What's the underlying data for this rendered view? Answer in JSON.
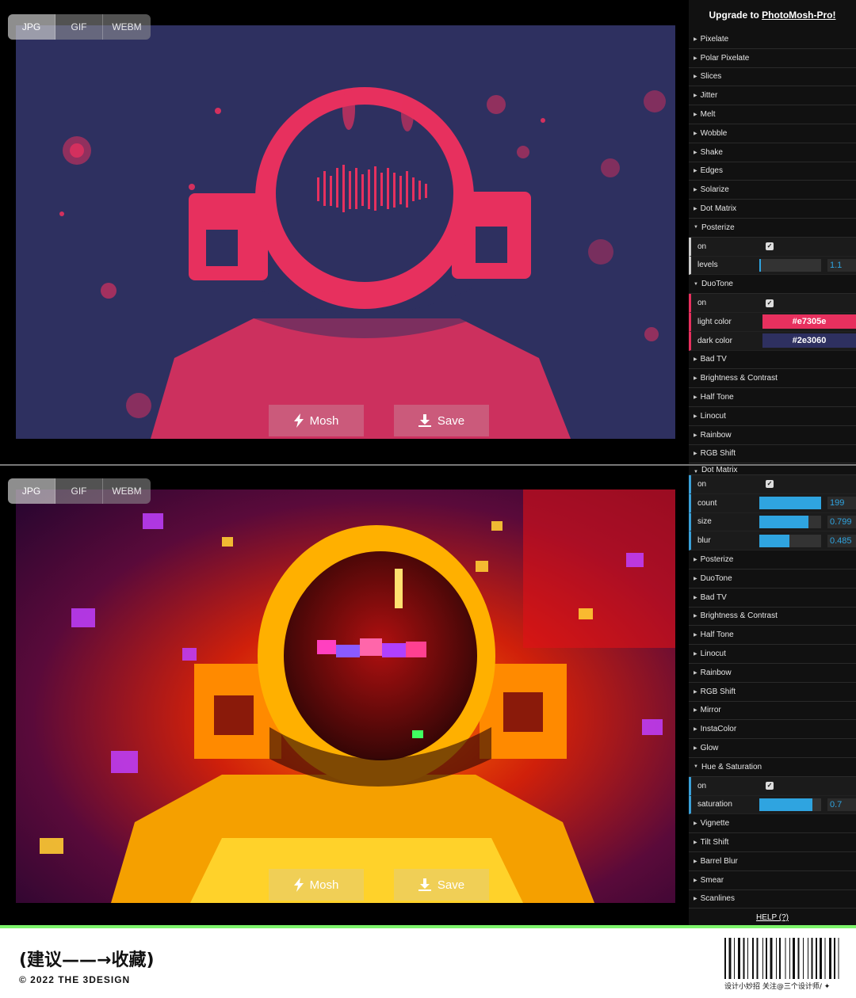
{
  "frame1": {
    "format_tabs": [
      "JPG",
      "GIF",
      "WEBM"
    ],
    "active_format": "JPG",
    "mosh_label": "Mosh",
    "save_label": "Save",
    "panel": {
      "upgrade_prefix": "Upgrade to ",
      "upgrade_link": "PhotoMosh-Pro!",
      "effects_before": [
        "Pixelate",
        "Polar Pixelate",
        "Slices",
        "Jitter",
        "Melt",
        "Wobble",
        "Shake",
        "Edges",
        "Solarize",
        "Dot Matrix"
      ],
      "posterize": {
        "label": "Posterize",
        "on_label": "on",
        "levels_label": "levels",
        "levels_value": "1.1",
        "levels_fill": 0.02
      },
      "duotone": {
        "label": "DuoTone",
        "on_label": "on",
        "light_label": "light color",
        "light_value": "#e7305e",
        "dark_label": "dark color",
        "dark_value": "#2e3060"
      },
      "effects_after": [
        "Bad TV",
        "Brightness & Contrast",
        "Half Tone",
        "Linocut",
        "Rainbow",
        "RGB Shift"
      ]
    }
  },
  "frame2": {
    "format_tabs": [
      "JPG",
      "GIF",
      "WEBM"
    ],
    "active_format": "JPG",
    "mosh_label": "Mosh",
    "save_label": "Save",
    "panel": {
      "dot_matrix": {
        "label": "Dot Matrix",
        "on_label": "on",
        "count_label": "count",
        "count_value": "199",
        "count_fill": 1.0,
        "size_label": "size",
        "size_value": "0.799",
        "size_fill": 0.8,
        "blur_label": "blur",
        "blur_value": "0.485",
        "blur_fill": 0.485
      },
      "effects_middle": [
        "Posterize",
        "DuoTone",
        "Bad TV",
        "Brightness & Contrast",
        "Half Tone",
        "Linocut",
        "Rainbow",
        "RGB Shift",
        "Mirror",
        "InstaColor",
        "Glow"
      ],
      "hue_saturation": {
        "label": "Hue & Saturation",
        "on_label": "on",
        "saturation_label": "saturation",
        "saturation_value": "0.7",
        "saturation_fill": 0.86
      },
      "effects_end": [
        "Vignette",
        "Tilt Shift",
        "Barrel Blur",
        "Smear",
        "Scanlines"
      ],
      "help_label": "HELP (?)"
    }
  },
  "footer": {
    "title": "(建议——→收藏)",
    "copyright": "© 2022 THE 3DESIGN",
    "caption": "设计小妙招  关注@三个设计师/",
    "caption_mark": "✦"
  },
  "colors": {
    "light": "#e7305e",
    "dark": "#2e3060",
    "accent": "#2fa4e0",
    "green": "#7df56b"
  }
}
